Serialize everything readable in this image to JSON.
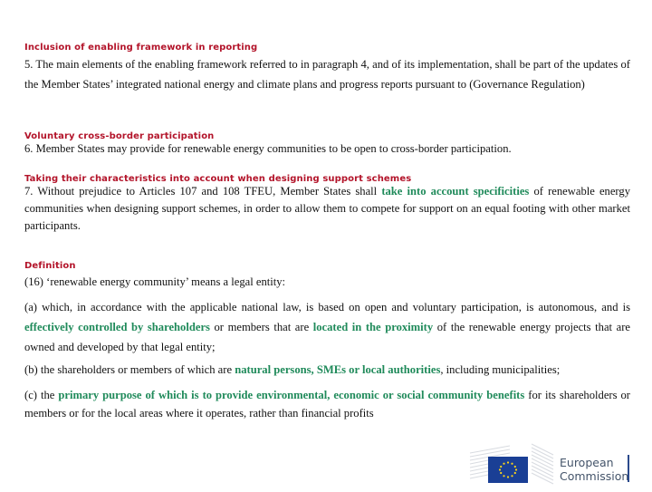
{
  "sections": {
    "s1": {
      "heading": "Inclusion of enabling framework in reporting",
      "text": "5. The main elements of the enabling framework referred to in paragraph 4, and of its implementation, shall be part of the updates of the Member States’ integrated national energy and climate plans and progress reports pursuant to (Governance Regulation)"
    },
    "s2": {
      "heading": "Voluntary cross-border participation",
      "text": "6. Member States may provide for renewable energy communities to be open to cross-border participation."
    },
    "s3": {
      "heading": "Taking their characteristics into account when designing support schemes",
      "t1": "7. Without prejudice to Articles 107 and 108 TFEU, Member States shall ",
      "h1": "take into account specificities",
      "t2": " of renewable energy communities when designing support schemes, in order to allow them to compete for support on an equal footing with other market participants."
    },
    "s4": {
      "heading": "Definition",
      "intro": "(16) ‘renewable energy community’ means a legal entity:",
      "a": {
        "t1": "(a) which, in accordance with the applicable national law, is based on open and voluntary participation, is autonomous, and is ",
        "h1": "effectively controlled by shareholders",
        "t2": " or members that are ",
        "h2": "located in the proximity",
        "t3": " of the renewable energy projects that are owned and developed by that legal entity;"
      },
      "b": {
        "t1": "(b) the shareholders or members of which are ",
        "h1": "natural persons, SMEs or local authorities",
        "t2": ", including municipalities;"
      },
      "c": {
        "t1": "(c) the ",
        "h1": "primary purpose of which is to provide environmental, economic or social community benefits",
        "t2": " for its shareholders or members or for the local areas where it operates, rather than financial profits"
      }
    }
  },
  "logo": {
    "line1": "European",
    "line2": "Commission",
    "icon": "eu-flag-icon"
  },
  "colors": {
    "heading": "#b3142a",
    "highlight": "#1f8a5a"
  }
}
